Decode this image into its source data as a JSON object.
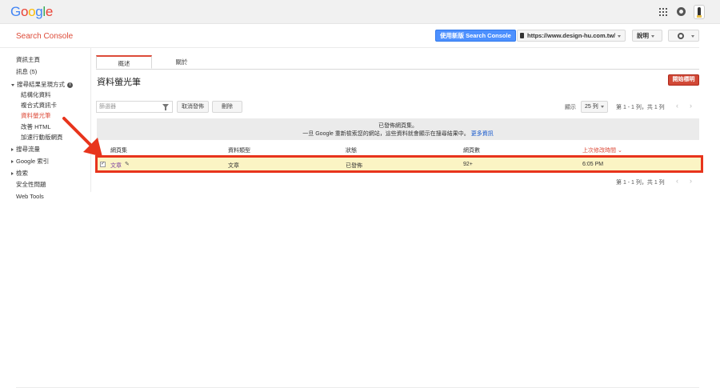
{
  "google_bar": {
    "logo_letters": [
      "G",
      "o",
      "o",
      "g",
      "l",
      "e"
    ],
    "icons": [
      "apps-grid-icon",
      "notifications-icon",
      "account-avatar"
    ]
  },
  "header": {
    "product_name": "Search Console",
    "new_version_button": "使用新版 Search Console",
    "site_url": "https://www.design-hu.com.tw/",
    "help_label": "說明",
    "settings_icon": "gear-icon"
  },
  "sidebar": {
    "items": [
      {
        "label": "資訊主頁"
      },
      {
        "label": "訊息 (5)"
      },
      {
        "label": "搜尋結果呈現方式"
      },
      {
        "label": "結構化資料"
      },
      {
        "label": "複合式資訊卡"
      },
      {
        "label": "資料螢光筆"
      },
      {
        "label": "改善 HTML"
      },
      {
        "label": "加速行動版網頁"
      },
      {
        "label": "搜尋流量"
      },
      {
        "label": "Google 索引"
      },
      {
        "label": "檢索"
      },
      {
        "label": "安全性問題"
      },
      {
        "label": "Web Tools"
      }
    ],
    "active_index": 5
  },
  "tabs": [
    {
      "label": "概述"
    },
    {
      "label": "關於"
    }
  ],
  "main": {
    "title": "資料螢光筆",
    "start_button": "開始標明",
    "filter_placeholder": "篩選器",
    "unpublish_button": "取消發佈",
    "delete_button": "刪除",
    "show_label": "顯示",
    "rows_per_page": "25 列",
    "pager_text": "第 1 - 1 列，共 1 列",
    "notice_line1": "已發佈網頁集。",
    "notice_line2": "一旦 Google 重新檢索您的網站，這些資料就會顯示在搜尋結果中。",
    "notice_link": "更多資訊"
  },
  "table": {
    "columns": [
      "網頁集",
      "資料類型",
      "狀態",
      "網頁數",
      "上次修改時間 ⌄"
    ],
    "rows": [
      {
        "page_set": "文章",
        "data_type": "文章",
        "status": "已發佈",
        "pages": "92+",
        "modified": "6:05 PM"
      }
    ]
  },
  "colors": {
    "accent_red": "#dd4b39",
    "primary_blue": "#4d90fe",
    "highlight_border": "#e8341c",
    "highlight_fill": "#fbf4c4"
  }
}
